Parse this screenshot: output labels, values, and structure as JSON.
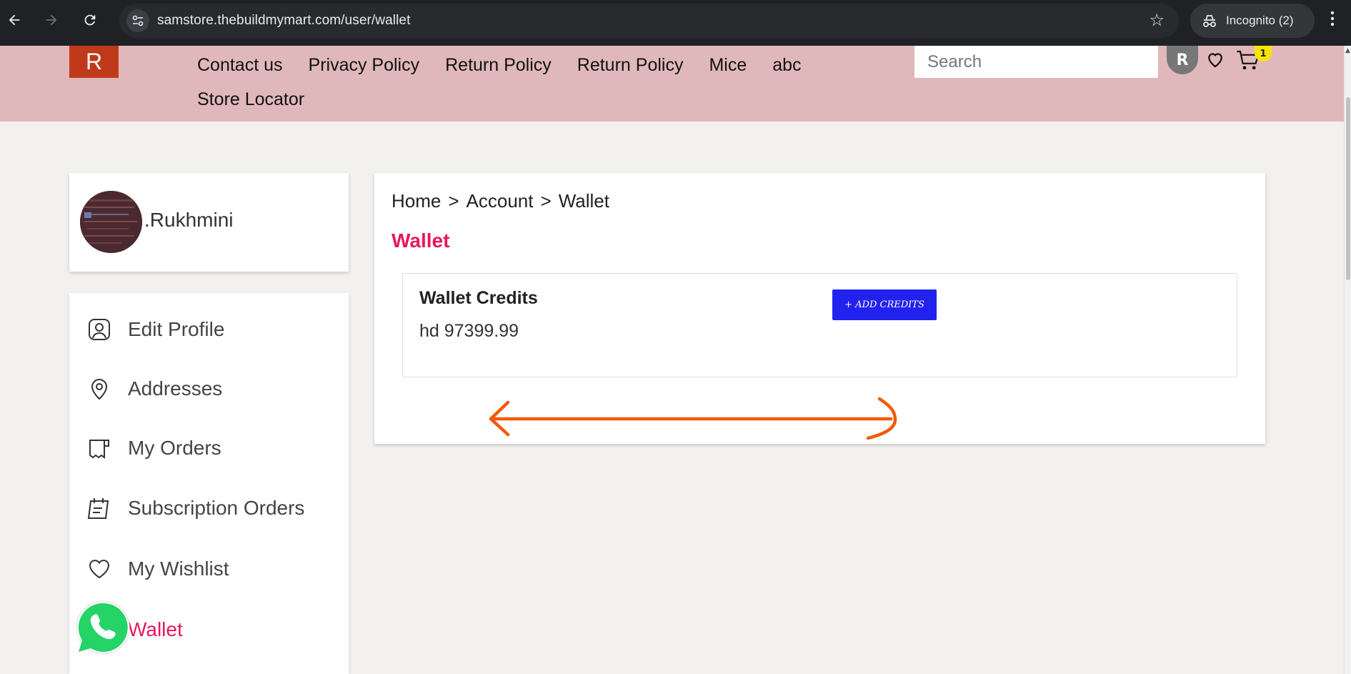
{
  "browser": {
    "url": "samstore.thebuildmymart.com/user/wallet",
    "incognito_label": "Incognito (2)",
    "icons": [
      "back-arrow-icon",
      "forward-arrow-icon",
      "reload-icon",
      "site-info-icon",
      "bookmark-star-icon",
      "incognito-icon",
      "more-menu-icon"
    ]
  },
  "header": {
    "logo_letter": "R",
    "nav": [
      "Contact us",
      "Privacy Policy",
      "Return Policy",
      "Return Policy",
      "Mice",
      "abc",
      "Store Locator"
    ],
    "search_placeholder": "Search",
    "avatar_letter": "R",
    "cart_count": "1",
    "colors": {
      "background": "#e0b8bb",
      "logo": "#c0391b",
      "cart_badge": "#f7e400"
    }
  },
  "sidebar": {
    "user_name": ".Rukhmini",
    "items": [
      {
        "label": "Edit Profile",
        "icon": "user-profile-icon"
      },
      {
        "label": "Addresses",
        "icon": "location-pin-icon"
      },
      {
        "label": "My Orders",
        "icon": "receipt-icon"
      },
      {
        "label": "Subscription Orders",
        "icon": "calendar-note-icon"
      },
      {
        "label": "My Wishlist",
        "icon": "heart-icon"
      },
      {
        "label": "Wallet",
        "icon": "wallet-icon",
        "active": true
      }
    ]
  },
  "main": {
    "breadcrumb": [
      "Home",
      ">",
      "Account",
      ">",
      "Wallet"
    ],
    "title": "Wallet",
    "wallet": {
      "title": "Wallet Credits",
      "amount": "hd 97399.99",
      "add_button": "+ ADD CREDITS"
    },
    "colors": {
      "accent": "#e8175d",
      "button": "#2222ee",
      "annotation": "#f25a0a"
    }
  }
}
